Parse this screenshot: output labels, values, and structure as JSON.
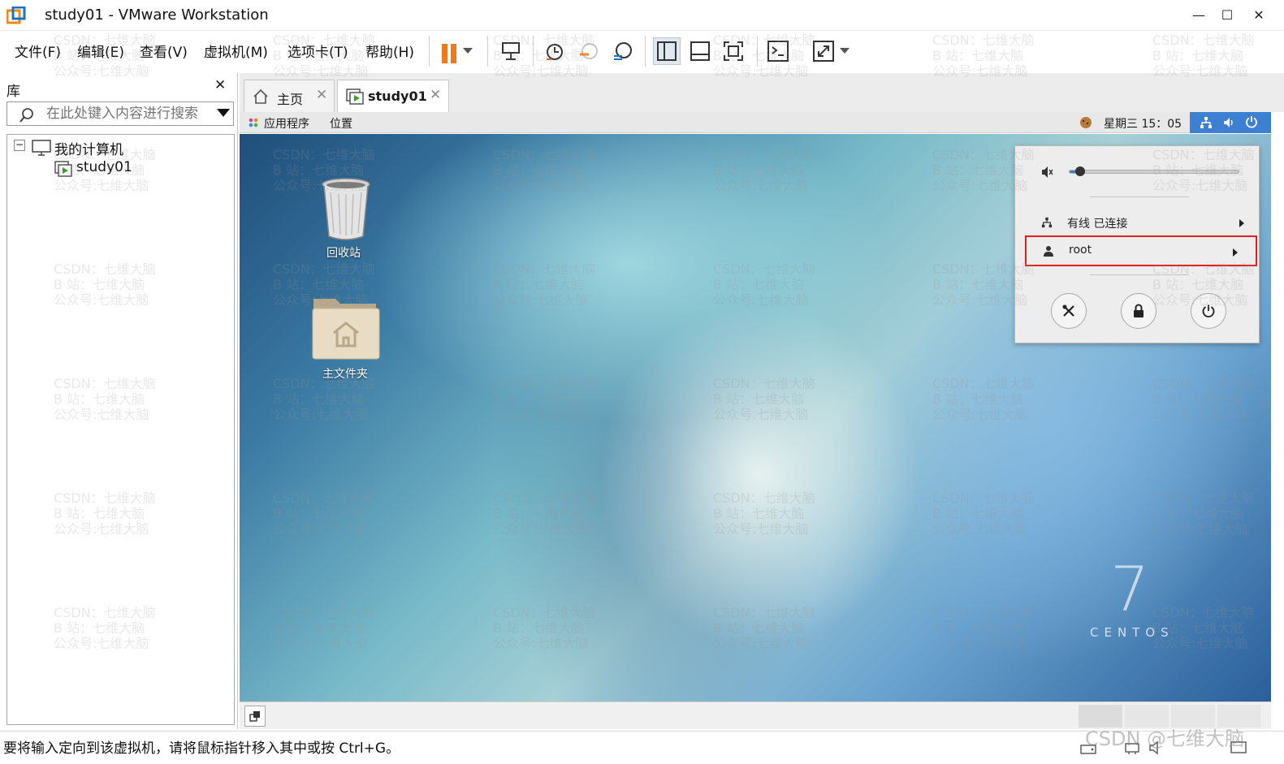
{
  "window": {
    "title": "study01 - VMware Workstation",
    "minimize": "—",
    "maximize": "☐",
    "close": "✕"
  },
  "menu": {
    "items": [
      "文件(F)",
      "编辑(E)",
      "查看(V)",
      "虚拟机(M)",
      "选项卡(T)",
      "帮助(H)"
    ]
  },
  "toolbar": {
    "icons": [
      "pause-icon",
      "send-ctrl-alt-del-icon",
      "snapshot-icon",
      "revert-snapshot-icon",
      "snapshot-manager-icon",
      "show-library-icon",
      "thumbnail-bar-icon",
      "full-screen-icon",
      "console-view-icon",
      "stretch-guest-icon"
    ]
  },
  "library": {
    "title": "库",
    "close": "✕",
    "search_placeholder": "在此处键入内容进行搜索",
    "tree": {
      "root_label": "我的计算机",
      "collapse": "−",
      "vm_label": "study01"
    }
  },
  "tabs": [
    {
      "label": "主页",
      "close": "✕"
    },
    {
      "label": "study01",
      "close": "✕"
    }
  ],
  "guest": {
    "panel": {
      "apps": "应用程序",
      "places": "位置",
      "clock": "星期三 15：05"
    },
    "desktop_icons": [
      {
        "label": "回收站"
      },
      {
        "label": "主文件夹"
      }
    ],
    "status_menu": {
      "volume_level": 0.06,
      "network_label": "有线 已连接",
      "user_label": "root",
      "highlight_color": "#e02020"
    },
    "centos_logo": {
      "numeral": "7",
      "text": "CENTOS"
    }
  },
  "statusbar": {
    "message": "要将输入定向到该虚拟机，请将鼠标指针移入其中或按 Ctrl+G。"
  },
  "watermark": {
    "line1": "CSDN：七维大脑",
    "line2": "B 站：七维大脑",
    "line3": "公众号:七维大脑",
    "corner": "CSDN @七维大脑"
  },
  "colors": {
    "pause_accent": "#f07a1a",
    "gnome_tray_bg": "#3d7fd1",
    "highlight_box": "#e02020"
  }
}
